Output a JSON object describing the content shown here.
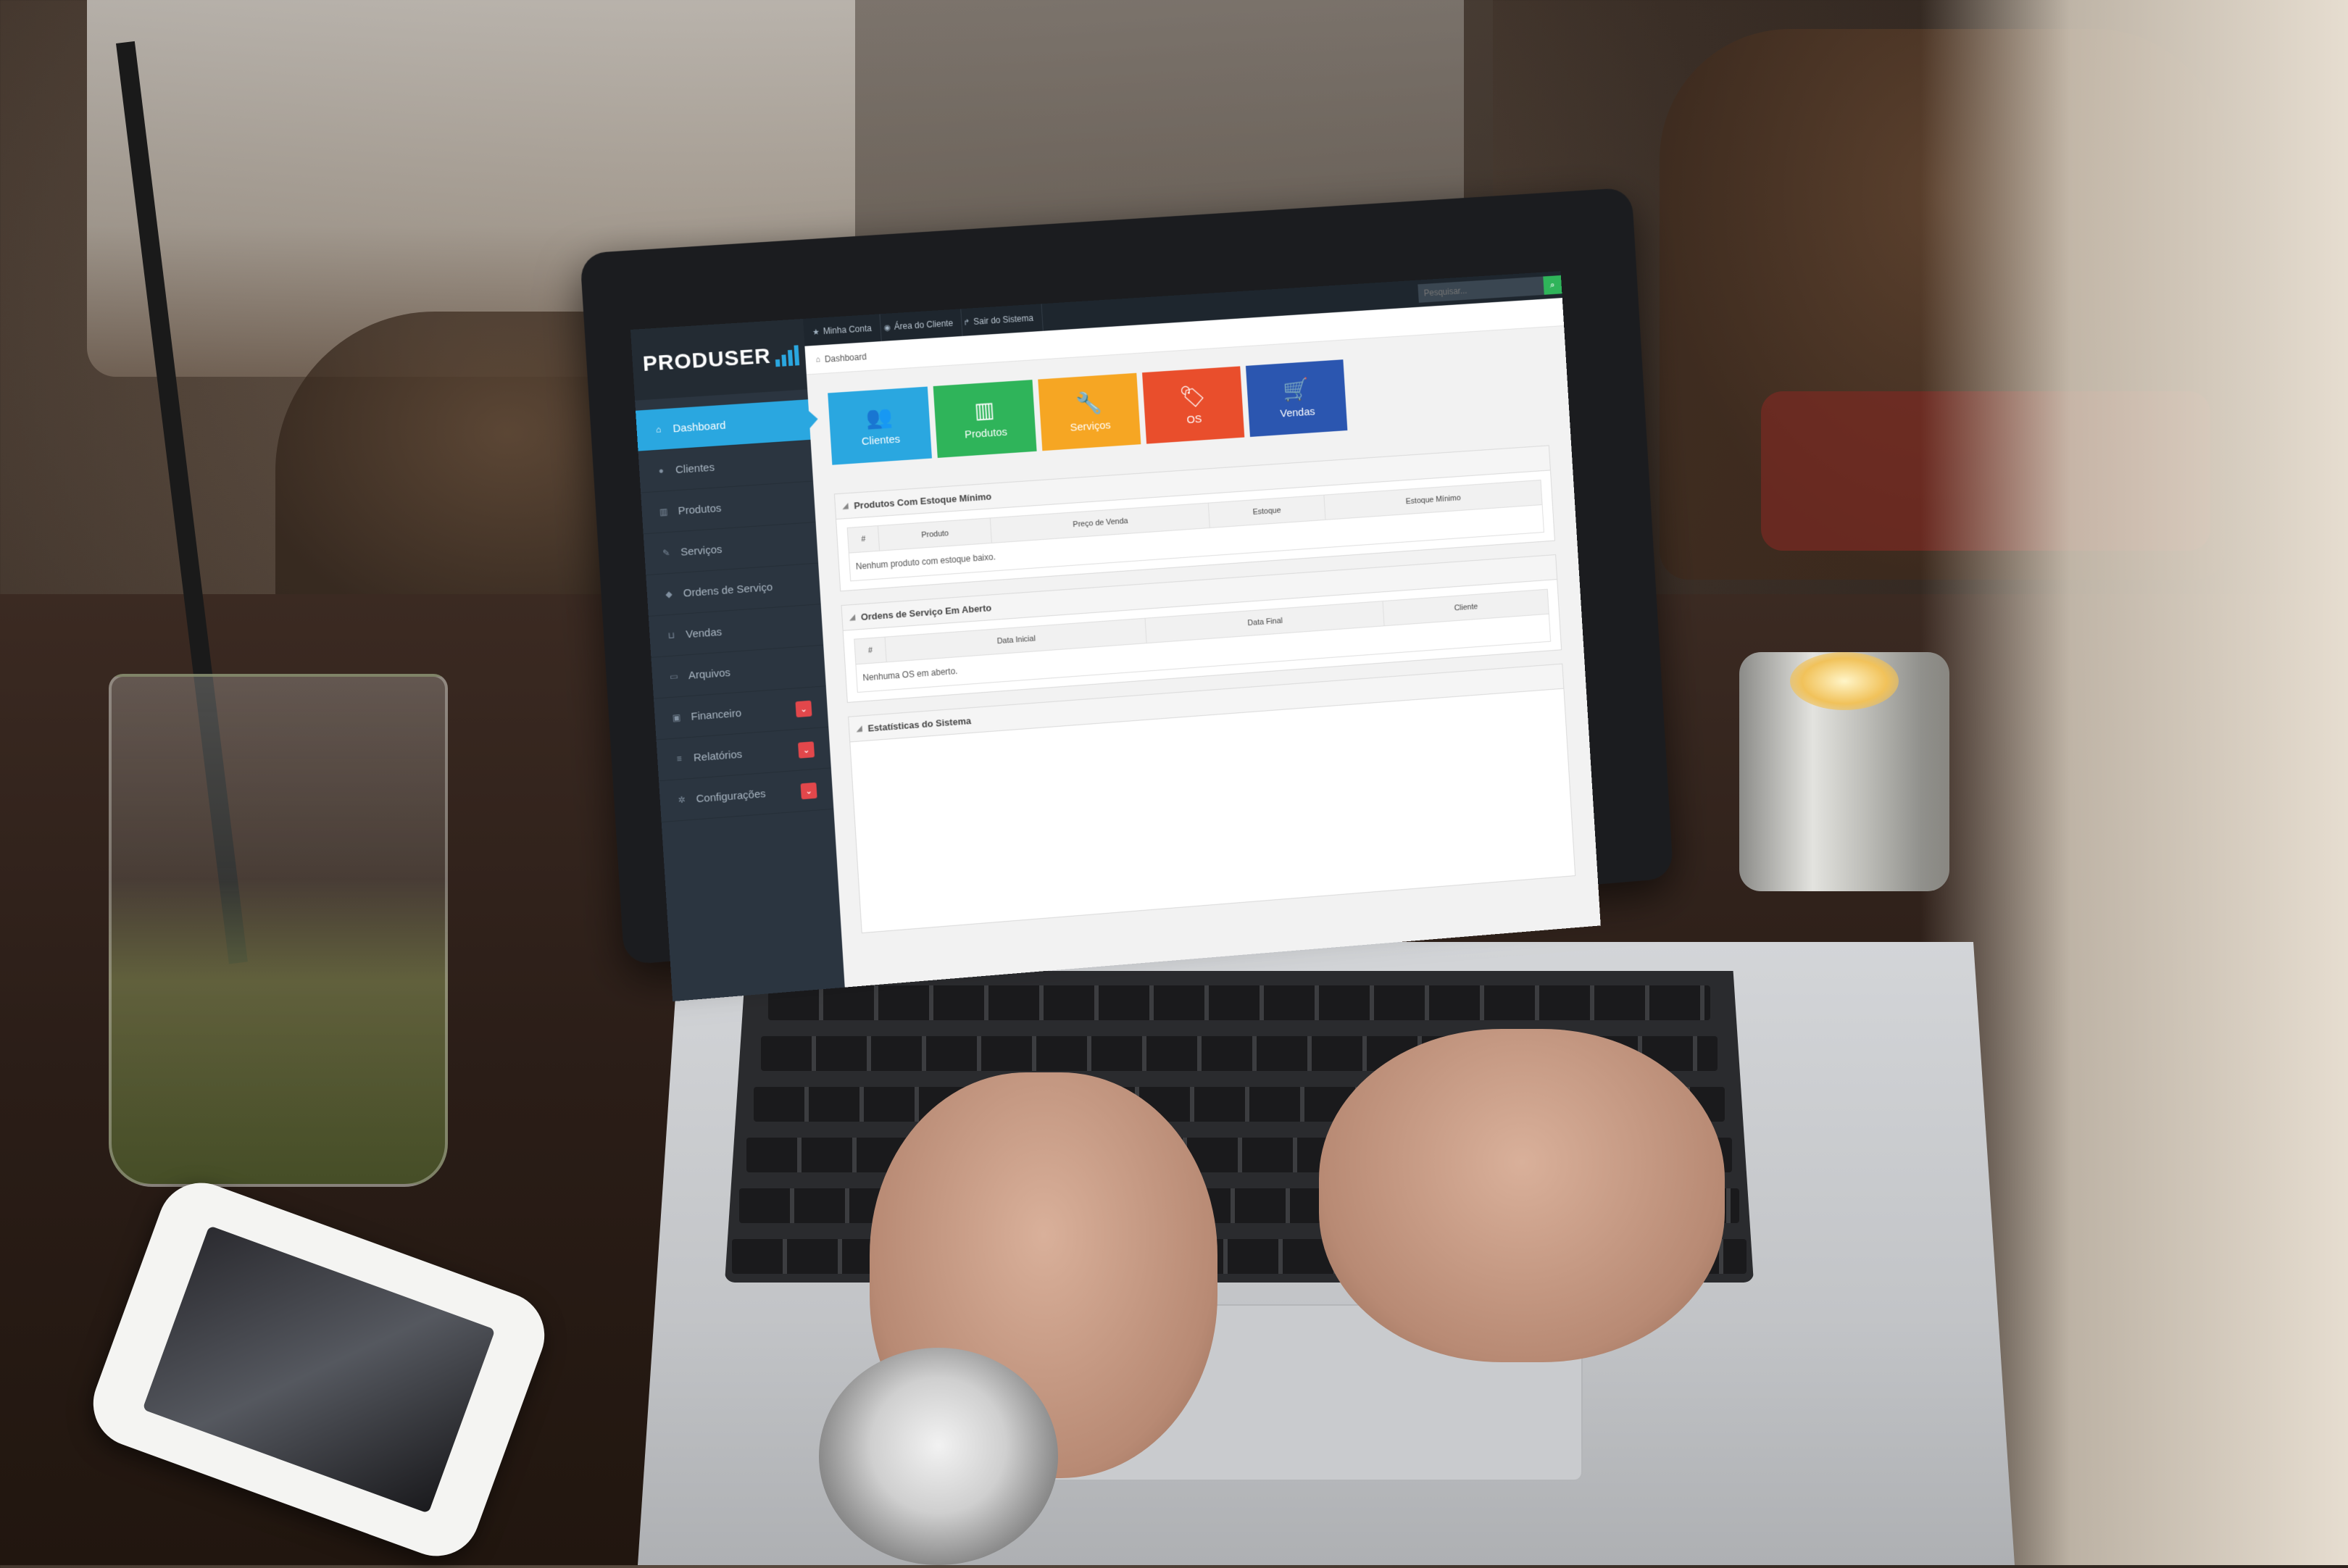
{
  "app": {
    "brand": "PRODUSER",
    "colors": {
      "sidebar": "#2b3540",
      "accent": "#2aa7e0",
      "clientes": "#2aa7e0",
      "produtos": "#2fb45a",
      "servicos": "#f6a623",
      "os": "#e94e2c",
      "vendas": "#2b56b0",
      "badge": "#e2474b"
    }
  },
  "topbar": {
    "links": [
      {
        "label": "Minha Conta",
        "icon": "star-icon"
      },
      {
        "label": "Área do Cliente",
        "icon": "eye-icon"
      },
      {
        "label": "Sair do Sistema",
        "icon": "exit-arrow-icon"
      }
    ],
    "search_placeholder": "Pesquisar...",
    "search_icon": "search-icon"
  },
  "sidebar": {
    "items": [
      {
        "label": "Dashboard",
        "icon": "home-icon",
        "active": true
      },
      {
        "label": "Clientes",
        "icon": "users-icon"
      },
      {
        "label": "Produtos",
        "icon": "barcode-icon"
      },
      {
        "label": "Serviços",
        "icon": "wrench-icon"
      },
      {
        "label": "Ordens de Serviço",
        "icon": "tag-icon"
      },
      {
        "label": "Vendas",
        "icon": "cart-icon"
      },
      {
        "label": "Arquivos",
        "icon": "file-icon"
      },
      {
        "label": "Financeiro",
        "icon": "money-icon",
        "has_submenu": true
      },
      {
        "label": "Relatórios",
        "icon": "list-icon",
        "has_submenu": true
      },
      {
        "label": "Configurações",
        "icon": "cog-icon",
        "has_submenu": true
      }
    ]
  },
  "breadcrumb": {
    "label": "Dashboard",
    "icon": "home-icon"
  },
  "tiles": [
    {
      "label": "Clientes",
      "icon": "users-icon"
    },
    {
      "label": "Produtos",
      "icon": "barcode-icon"
    },
    {
      "label": "Serviços",
      "icon": "wrench-icon"
    },
    {
      "label": "OS",
      "icon": "tags-icon"
    },
    {
      "label": "Vendas",
      "icon": "cart-icon"
    }
  ],
  "panels": {
    "estoque": {
      "title": "Produtos Com Estoque Mínimo",
      "columns": [
        "#",
        "Produto",
        "Preço de Venda",
        "Estoque",
        "Estoque Mínimo"
      ],
      "empty_message": "Nenhum produto com estoque baixo."
    },
    "os": {
      "title": "Ordens de Serviço Em Aberto",
      "columns": [
        "#",
        "Data Inicial",
        "Data Final",
        "Cliente"
      ],
      "empty_message": "Nenhuma OS em aberto."
    },
    "stats": {
      "title": "Estatísticas do Sistema"
    }
  }
}
